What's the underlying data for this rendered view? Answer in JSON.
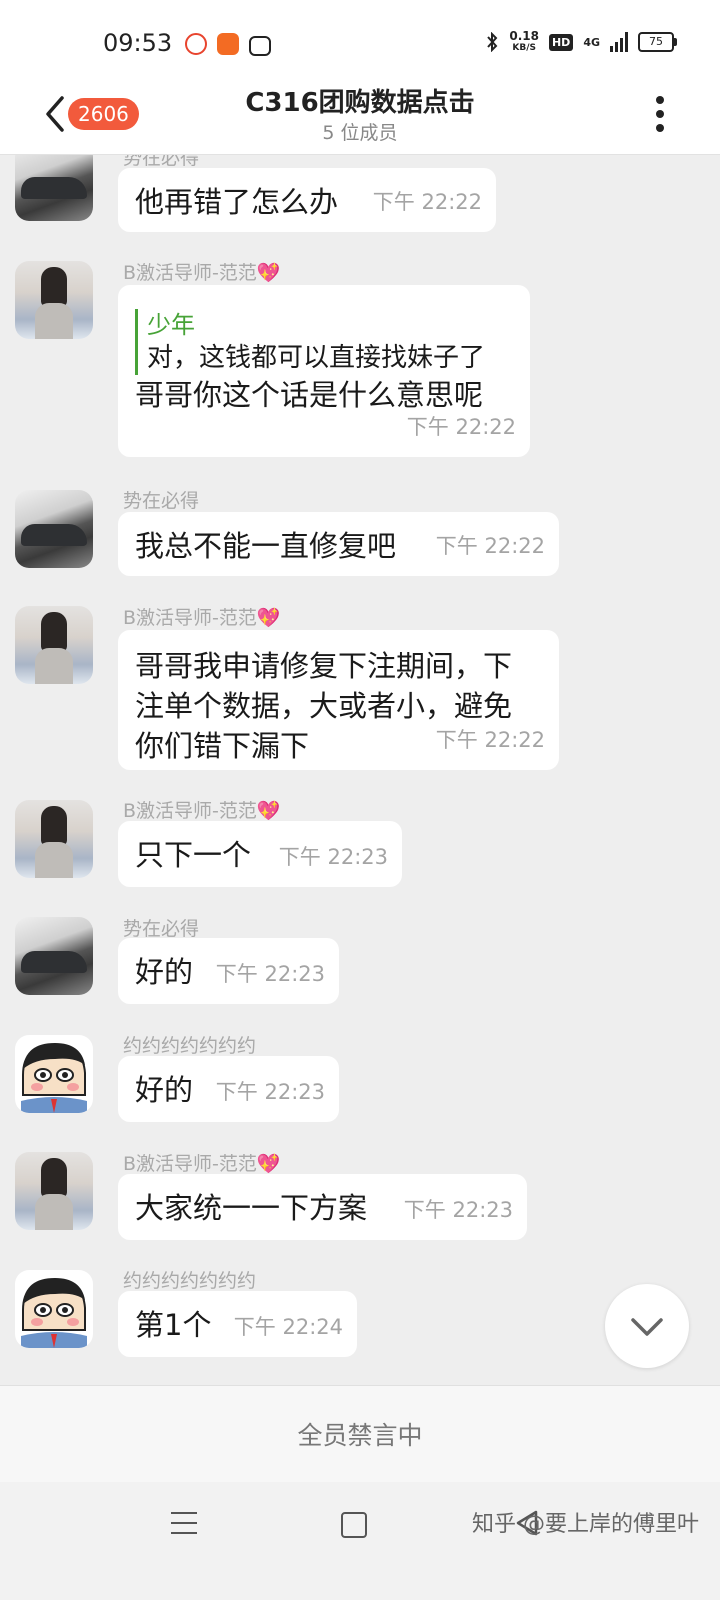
{
  "status_bar": {
    "time": "09:53",
    "net_speed_value": "0.18",
    "net_speed_unit": "KB/S",
    "hd_label": "HD",
    "network_label": "4G",
    "battery": "75"
  },
  "header": {
    "unread_count": "2606",
    "title": "C316团购数据点击",
    "subtitle": "5 位成员"
  },
  "messages": [
    {
      "sender": "势在必得",
      "text": "他再错了怎么办",
      "time": "下午  22:22"
    },
    {
      "sender": "B激活导师-范范💖",
      "quote_name": "少年",
      "quote_text": "对，这钱都可以直接找妹子了",
      "text": "哥哥你这个话是什么意思呢",
      "time": "下午  22:22"
    },
    {
      "sender": "势在必得",
      "text": "我总不能一直修复吧",
      "time": "下午  22:22"
    },
    {
      "sender": "B激活导师-范范💖",
      "text_line1": "哥哥我申请修复下注期间，下",
      "text_line2": "注单个数据，大或者小，避免",
      "text_line3": "你们错下漏下",
      "time": "下午  22:22"
    },
    {
      "sender": "B激活导师-范范💖",
      "text": "只下一个",
      "time": "下午  22:23"
    },
    {
      "sender": "势在必得",
      "text": "好的",
      "time": "下午  22:23"
    },
    {
      "sender": "约约约约约约约",
      "text": "好的",
      "time": "下午  22:23"
    },
    {
      "sender": "B激活导师-范范💖",
      "text": "大家统一一下方案",
      "time": "下午  22:23"
    },
    {
      "sender": "约约约约约约约",
      "text": "第1个",
      "time": "下午  22:24"
    }
  ],
  "footer": {
    "muted_notice": "全员禁言中"
  },
  "watermark": "知乎 @要上岸的傅里叶",
  "colors": {
    "badge": "#f25a3c",
    "quote_accent": "#47a337",
    "chat_bg": "#eeeeee"
  }
}
